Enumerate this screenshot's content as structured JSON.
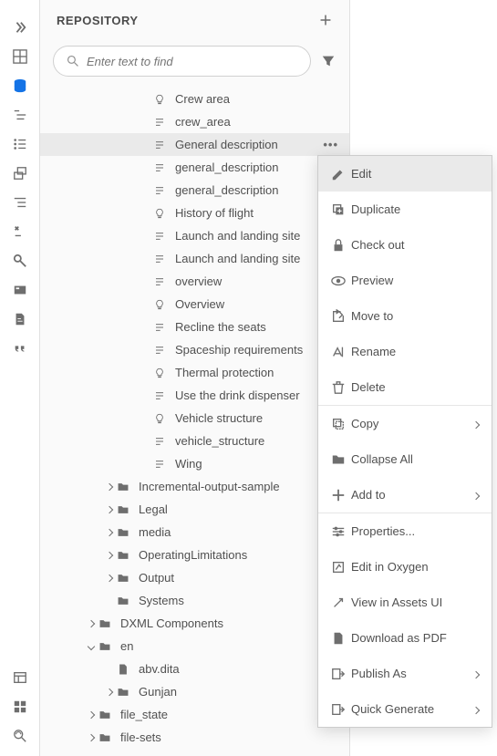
{
  "panel": {
    "title": "REPOSITORY"
  },
  "search": {
    "placeholder": "Enter text to find"
  },
  "tree": {
    "level4": [
      {
        "icon": "bulb",
        "label": "Crew area"
      },
      {
        "icon": "doc",
        "label": "crew_area"
      },
      {
        "icon": "doc",
        "label": "General description",
        "selected": true
      },
      {
        "icon": "doc",
        "label": "general_description"
      },
      {
        "icon": "doc",
        "label": "general_description"
      },
      {
        "icon": "bulb",
        "label": "History of flight"
      },
      {
        "icon": "doc",
        "label": "Launch and landing site"
      },
      {
        "icon": "doc",
        "label": "Launch and landing site"
      },
      {
        "icon": "doc",
        "label": "overview"
      },
      {
        "icon": "bulb",
        "label": "Overview"
      },
      {
        "icon": "doc",
        "label": "Recline the seats"
      },
      {
        "icon": "doc",
        "label": "Spaceship requirements"
      },
      {
        "icon": "bulb",
        "label": "Thermal protection"
      },
      {
        "icon": "doc",
        "label": "Use the drink dispenser"
      },
      {
        "icon": "bulb",
        "label": "Vehicle structure"
      },
      {
        "icon": "doc",
        "label": "vehicle_structure"
      },
      {
        "icon": "doc",
        "label": "Wing"
      }
    ],
    "folders3": [
      "Incremental-output-sample",
      "Legal",
      "media",
      "OperatingLimitations",
      "Output",
      "Systems"
    ],
    "lower": [
      {
        "chev": "right",
        "indent": 1,
        "icon": "folder",
        "label": "DXML Components"
      },
      {
        "chev": "down",
        "indent": 1,
        "icon": "folder",
        "label": "en"
      },
      {
        "chev": "",
        "indent": 2,
        "icon": "file",
        "label": "abv.dita"
      },
      {
        "chev": "right",
        "indent": 2,
        "icon": "folder",
        "label": "Gunjan"
      },
      {
        "chev": "right",
        "indent": 1,
        "icon": "folder",
        "label": "file_state"
      },
      {
        "chev": "right",
        "indent": 1,
        "icon": "folder",
        "label": "file-sets"
      }
    ]
  },
  "menu": {
    "items": [
      {
        "icon": "edit",
        "label": "Edit",
        "hover": true
      },
      {
        "icon": "duplicate",
        "label": "Duplicate"
      },
      {
        "icon": "lock",
        "label": "Check out"
      },
      {
        "icon": "eye",
        "label": "Preview"
      },
      {
        "icon": "moveto",
        "label": "Move to"
      },
      {
        "icon": "rename",
        "label": "Rename"
      },
      {
        "icon": "trash",
        "label": "Delete"
      },
      {
        "icon": "copy",
        "label": "Copy",
        "sub": true,
        "div_before": true
      },
      {
        "icon": "collapse",
        "label": "Collapse All"
      },
      {
        "icon": "add",
        "label": "Add to",
        "sub": true
      },
      {
        "icon": "props",
        "label": "Properties...",
        "div_before": true
      },
      {
        "icon": "oxygen",
        "label": "Edit in Oxygen"
      },
      {
        "icon": "assets",
        "label": "View in Assets UI"
      },
      {
        "icon": "pdf",
        "label": "Download as PDF"
      },
      {
        "icon": "publish",
        "label": "Publish As",
        "sub": true
      },
      {
        "icon": "quick",
        "label": "Quick Generate",
        "sub": true
      }
    ]
  }
}
